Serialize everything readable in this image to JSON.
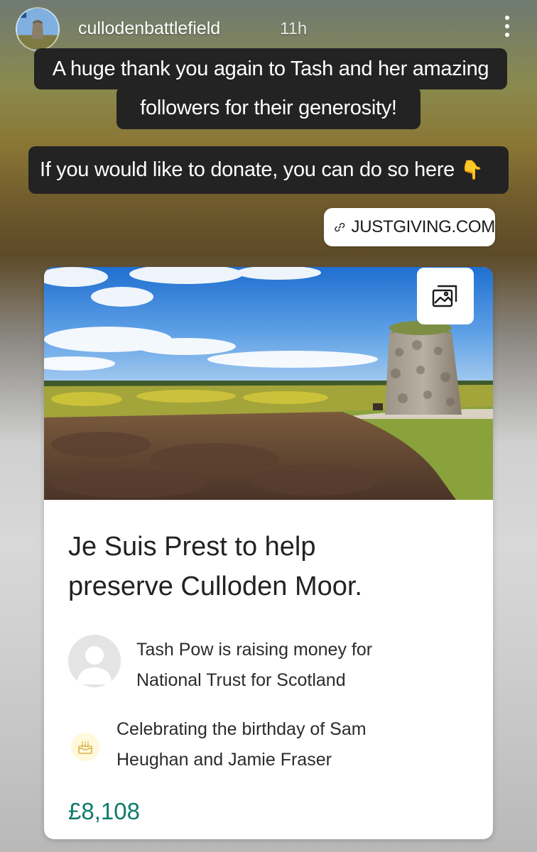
{
  "header": {
    "username": "cullodenbattlefield",
    "time": "11h"
  },
  "captions": {
    "line1": "A huge thank you again to Tash and her amazing",
    "line2": "followers for their generosity!",
    "line3": "If you would like to donate, you can do so here",
    "emoji": "👇"
  },
  "link_sticker": {
    "label": "JUSTGIVING.COM"
  },
  "card": {
    "title_line1": "Je Suis Prest to help",
    "title_line2": "preserve Culloden Moor.",
    "organizer_line1": "Tash Pow is raising money for",
    "organizer_line2": "National Trust for Scotland",
    "celebrating_line1": "Celebrating the birthday of Sam",
    "celebrating_line2": "Heughan and Jamie Fraser",
    "amount": "£8,108"
  },
  "colors": {
    "caption_bg": "#232323",
    "amount_green": "#0e7b6c",
    "sky": "#2f7fd8",
    "heather": "#6b4a3a"
  },
  "icons": {
    "more": "more-vertical-icon",
    "link": "link-icon",
    "gallery": "image-gallery-icon",
    "cake": "cake-icon",
    "profile": "default-profile-icon"
  }
}
